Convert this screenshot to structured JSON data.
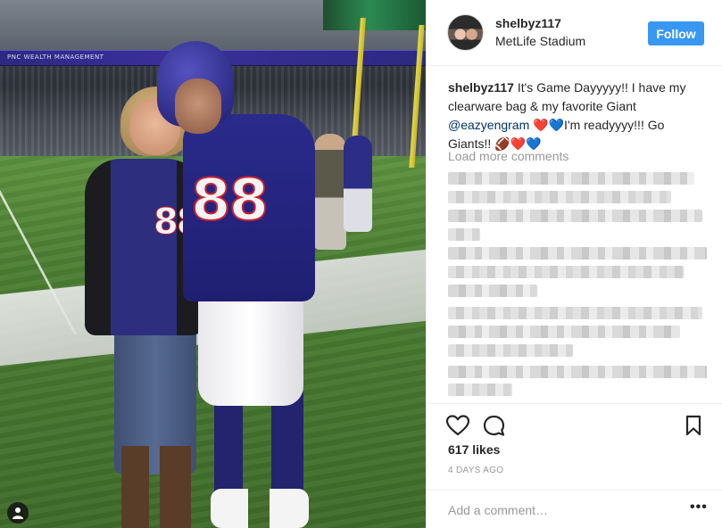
{
  "post": {
    "username": "shelbyz117",
    "location": "MetLife Stadium",
    "follow_label": "Follow",
    "caption": {
      "user": "shelbyz117",
      "text_1": " It's Game Dayyyyy!! I have my clearware bag & my favorite Giant ",
      "mention": "@eazyengram",
      "text_2": " ",
      "hearts_1": "❤️💙",
      "text_3": "I'm readyyyy!!! Go Giants!! ",
      "football": "🏈",
      "hearts_2": "❤️💙"
    },
    "load_more": "Load more comments",
    "likes": "617 likes",
    "time_ago": "4 DAYS AGO",
    "comment_placeholder": "Add a comment…",
    "more_options": "•••"
  },
  "photo": {
    "banner_text": "PNC WEALTH MANAGEMENT",
    "jersey_number": "88",
    "shirt_number": "88"
  },
  "icons": {
    "like": "heart-icon",
    "comment": "comment-icon",
    "save": "bookmark-icon",
    "tag": "user-tag-icon",
    "more": "more-options-icon"
  },
  "colors": {
    "accent": "#3897f0",
    "mention": "#003569",
    "muted": "#999999"
  }
}
